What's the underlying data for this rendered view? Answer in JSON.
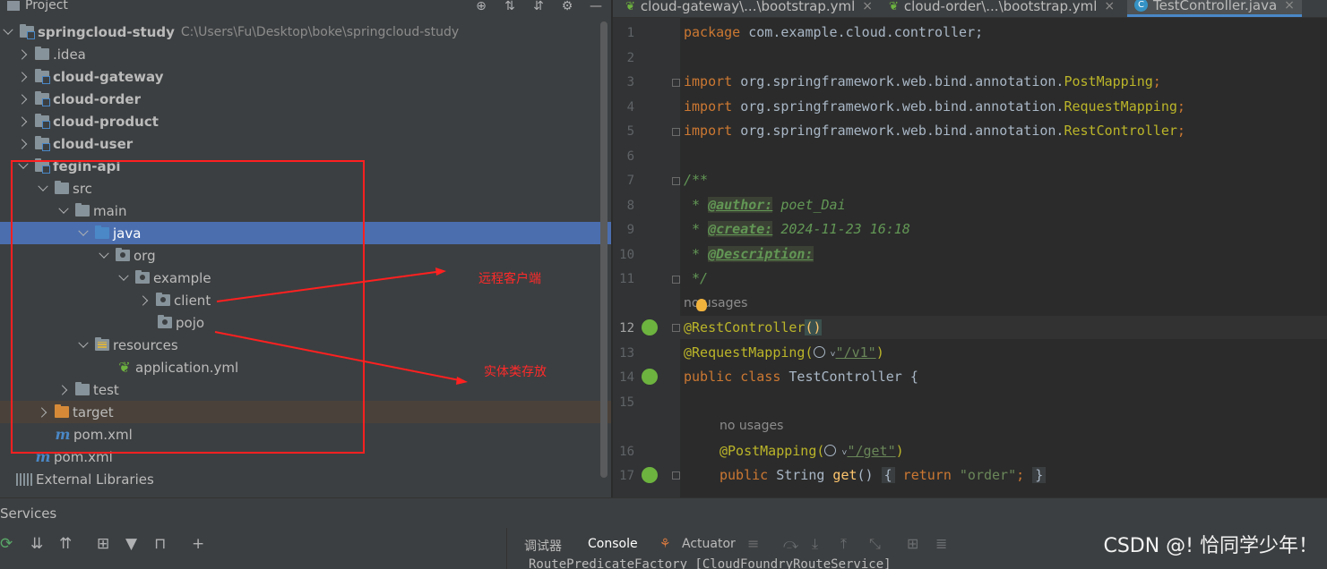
{
  "project": {
    "title": "Project",
    "tree": [
      {
        "label": "springcloud-study",
        "path": "C:\\Users\\Fu\\Desktop\\boke\\springcloud-study"
      },
      {
        "label": ".idea"
      },
      {
        "label": "cloud-gateway"
      },
      {
        "label": "cloud-order"
      },
      {
        "label": "cloud-product"
      },
      {
        "label": "cloud-user"
      },
      {
        "label": "fegin-api"
      },
      {
        "label": "src"
      },
      {
        "label": "main"
      },
      {
        "label": "java"
      },
      {
        "label": "org"
      },
      {
        "label": "example"
      },
      {
        "label": "client"
      },
      {
        "label": "pojo"
      },
      {
        "label": "resources"
      },
      {
        "label": "application.yml"
      },
      {
        "label": "test"
      },
      {
        "label": "target"
      },
      {
        "label": "pom.xml"
      },
      {
        "label": "pom.xml"
      },
      {
        "label": "External Libraries"
      }
    ]
  },
  "annotations": {
    "client_note": "远程客户端",
    "pojo_note": "实体类存放"
  },
  "editor": {
    "tabs": [
      {
        "label": "cloud-gateway\\...\\bootstrap.yml"
      },
      {
        "label": "cloud-order\\...\\bootstrap.yml"
      },
      {
        "label": "TestController.java"
      }
    ],
    "line_numbers": [
      "1",
      "2",
      "3",
      "4",
      "5",
      "6",
      "7",
      "8",
      "9",
      "10",
      "11",
      "12",
      "13",
      "14",
      "15",
      "16",
      "17"
    ],
    "code": {
      "pkg_kw": "package",
      "pkg_name": " com.example.cloud.controller;",
      "imp_kw": "import",
      "imp_base": " org.springframework.web.bind.annotation.",
      "imp1": "PostMapping",
      "imp2": "RequestMapping",
      "imp3": "RestController",
      "semi": ";",
      "doc_open": "/**",
      "doc_star": " * ",
      "author_tag": "@author:",
      "author_val": " poet_Dai",
      "create_tag": "@create:",
      "create_val": " 2024-11-23 16:18",
      "desc_tag": "@Description:",
      "doc_close": " */",
      "no_usages_1": "no usages",
      "rest_ann": "@RestController",
      "rest_paren": "()",
      "req_ann": "@RequestMapping(",
      "req_path": "\"/v1\"",
      "close_paren": ")",
      "pub_kw": "public",
      "class_kw": " class",
      "class_name": " TestController {",
      "no_usages_2": "no usages",
      "post_ann": "@PostMapping(",
      "post_path": "\"/get\"",
      "pub2": "public",
      "string_type": " String",
      "method": " get",
      "method_paren": "()",
      "return_kw": " return",
      "return_val": " \"order\"",
      "brace_open": "{",
      "brace_close": "}"
    }
  },
  "services": {
    "title": "Services",
    "tabs": [
      {
        "label": "调试器"
      },
      {
        "label": "Console"
      },
      {
        "label": "Actuator"
      }
    ],
    "console_line": "RoutePredicateFactory [CloudFoundryRouteService]"
  },
  "watermark": "CSDN @! 恰同学少年！"
}
